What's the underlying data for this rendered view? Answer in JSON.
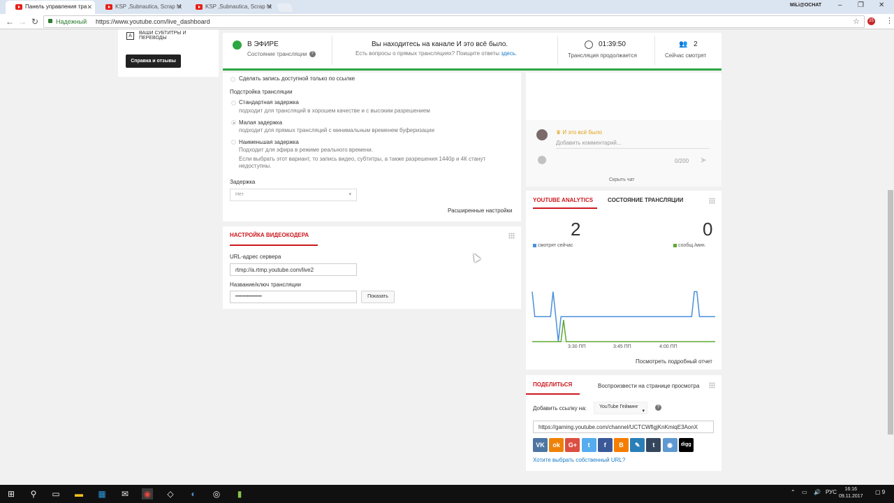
{
  "browser": {
    "tabs": [
      {
        "title": "Панель управления тра",
        "active": true
      },
      {
        "title": "KSP ,Subnautica, Scrap M",
        "active": false
      },
      {
        "title": "KSP ,Subnautica, Scrap M",
        "active": false
      }
    ],
    "user": "MiLi@OCHAT",
    "secure_label": "Надежный",
    "url": "https://www.youtube.com/live_dashboard",
    "ext_badge": "25"
  },
  "sidebar": {
    "subtitles": "Ваши субтитры и переводы",
    "help_button": "Справка и отзывы"
  },
  "status": {
    "live_label": "В ЭФИРЕ",
    "live_sub": "Состояние трансляции",
    "message": "Вы находитесь на канале И это всё было.",
    "question": "Есть вопросы о прямых трансляциях? Поищите ответы",
    "question_link": "здесь",
    "duration": "01:39:50",
    "duration_label": "Трансляция продолжается",
    "viewers": "2",
    "viewers_label": "Сейчас смотрят"
  },
  "settings": {
    "unlisted": "Сделать запись доступной только по ссылке",
    "tuning_title": "Подстройка трансляции",
    "options": [
      {
        "label": "Стандартная задержка",
        "desc": "подходит для трансляций в хорошем качестве и с высоким разрешением",
        "selected": false
      },
      {
        "label": "Малая задержка",
        "desc": "подходит для прямых трансляций с минимальным временем буферизации",
        "selected": true
      },
      {
        "label": "Наименьшая задержка",
        "desc": "Подходит для эфира в режиме реального времени.",
        "note": "Если выбрать этот вариант, то запись видео, субтитры, а также разрешения 1440p и 4К станут недоступны.",
        "selected": false
      }
    ],
    "delay_label": "Задержка",
    "delay_value": "Нет",
    "advanced": "Расширенные настройки"
  },
  "encoder": {
    "title": "НАСТРОЙКА ВИДЕОКОДЕРА",
    "server_label": "URL-адрес сервера",
    "server_value": "rtmp://a.rtmp.youtube.com/live2",
    "key_label": "Название/ключ трансляции",
    "key_value": "••••••••••••••••••",
    "show_button": "Показать"
  },
  "chat": {
    "author": "И это всё было",
    "placeholder": "Добавить комментарий...",
    "counter": "0/200",
    "hide": "Скрыть чат"
  },
  "analytics": {
    "tab1": "YOUTUBE ANALYTICS",
    "tab2": "СОСТОЯНИЕ ТРАНСЛЯЦИИ",
    "watching": "2",
    "watching_label": "смотрят сейчас",
    "messages": "0",
    "messages_label": "сообщ./мин.",
    "detail_link": "Посмотреть подробный отчет",
    "colors": {
      "watching": "#4a90d9",
      "messages": "#5fa832"
    }
  },
  "chart_data": {
    "type": "line",
    "x_labels": [
      "3:30 ПП",
      "3:45 ПП",
      "4:00 ПП"
    ],
    "series": [
      {
        "name": "смотрят сейчас",
        "values": [
          2,
          1,
          1,
          1,
          1,
          1,
          1,
          1,
          2,
          1,
          0,
          1,
          1,
          1,
          1,
          1,
          1,
          1,
          1,
          1,
          1,
          1,
          1,
          1,
          1,
          1,
          1,
          1,
          1,
          1,
          1,
          1,
          1,
          1,
          1,
          1,
          1,
          1,
          1,
          1,
          1,
          1,
          1,
          1,
          1,
          1,
          1,
          1,
          1,
          1,
          1,
          1,
          1,
          1,
          1,
          1,
          1,
          1,
          1,
          1,
          1,
          1,
          2,
          2,
          1,
          1,
          1,
          1,
          1,
          1,
          1
        ]
      },
      {
        "name": "сообщ./мин.",
        "values": [
          0,
          0,
          0,
          0,
          0,
          0,
          0,
          0,
          0,
          0,
          0,
          0,
          1,
          0,
          0,
          0,
          0,
          0,
          0,
          0,
          0,
          0,
          0,
          0,
          0,
          0,
          0,
          0,
          0,
          0,
          0,
          0,
          0,
          0,
          0,
          0,
          0,
          0,
          0,
          0,
          0,
          0,
          0,
          0,
          0,
          0,
          0,
          0,
          0,
          0,
          0,
          0,
          0,
          0,
          0,
          0,
          0,
          0,
          0,
          0,
          0,
          0,
          0,
          0,
          0,
          0,
          0,
          0,
          0,
          0,
          0
        ]
      }
    ]
  },
  "share": {
    "title": "ПОДЕЛИТЬСЯ",
    "tab2": "Воспроизвести на странице просмотра",
    "add_link": "Добавить ссылку на:",
    "gaming": "YouTube Гейминг",
    "url": "https://gaming.youtube.com/channel/UCTCWfigjKnKmiqE3AonX",
    "social": [
      {
        "name": "vk",
        "label": "VK",
        "color": "#4c75a3"
      },
      {
        "name": "ok",
        "label": "ok",
        "color": "#ee8208"
      },
      {
        "name": "gplus",
        "label": "G+",
        "color": "#dc4e41"
      },
      {
        "name": "twitter",
        "label": "t",
        "color": "#55acee"
      },
      {
        "name": "facebook",
        "label": "f",
        "color": "#3b5998"
      },
      {
        "name": "blogger",
        "label": "B",
        "color": "#f57d00"
      },
      {
        "name": "livejournal",
        "label": "✎",
        "color": "#2a7fb8"
      },
      {
        "name": "tumblr",
        "label": "t",
        "color": "#35465c"
      },
      {
        "name": "reddit",
        "label": "◉",
        "color": "#5f99cf"
      },
      {
        "name": "digg",
        "label": "digg",
        "color": "#000000"
      }
    ],
    "own_url": "Хотите выбрать собственный URL?"
  },
  "taskbar": {
    "lang": "РУС",
    "time": "16:16",
    "date": "09.11.2017",
    "notifications": "9"
  }
}
